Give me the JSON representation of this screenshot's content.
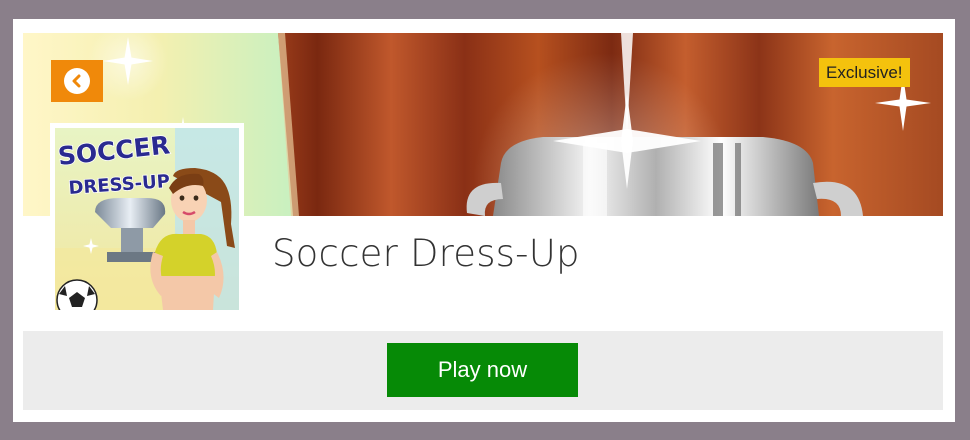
{
  "game": {
    "title": "Soccer Dress-Up",
    "badge": "Exclusive!",
    "thumbnail_logo_line1": "SOCCER",
    "thumbnail_logo_line2": "DRESS-UP"
  },
  "actions": {
    "back_icon": "chevron-left-icon",
    "play_label": "Play now"
  },
  "colors": {
    "back_button": "#f0890a",
    "badge": "#f4c20d",
    "play_button": "#068a06",
    "play_bar": "#ececec",
    "outer_background": "#8a7f8a"
  }
}
